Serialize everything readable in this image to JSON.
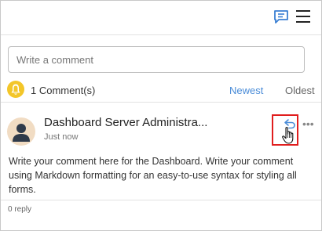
{
  "header": {
    "chat_icon": "comment-icon",
    "menu_icon": "hamburger-menu-icon",
    "accent_color": "#4a8cd8"
  },
  "composer": {
    "placeholder": "Write a comment"
  },
  "toolbar": {
    "badge_icon": "bell-icon",
    "comment_count": "1 Comment(s)",
    "sort_newest": "Newest",
    "sort_oldest": "Oldest"
  },
  "comment": {
    "author": "Dashboard Server Administra...",
    "time": "Just now",
    "body": "Write your comment here for the Dashboard. Write your comment using Markdown formatting for an easy-to-use syntax for styling all forms.",
    "reply_icon": "reply-icon",
    "more_icon": "more-options-icon",
    "reply_count": "0 reply"
  },
  "highlight_color": "#e01e1e"
}
